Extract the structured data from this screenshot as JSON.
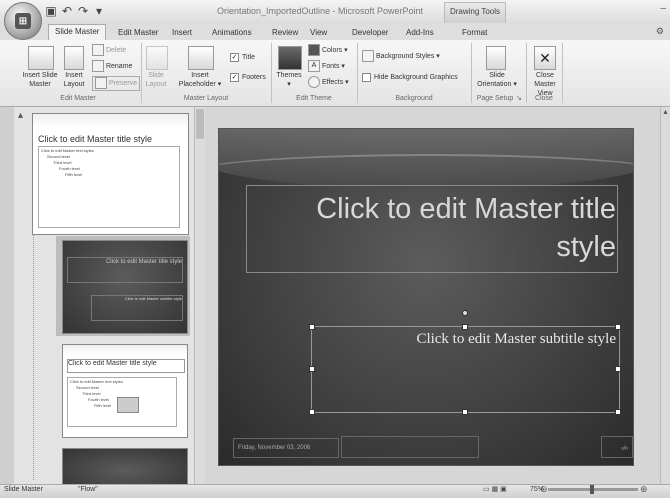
{
  "window": {
    "title": "Orientation_ImportedOutline - Microsoft PowerPoint",
    "contextual_tab_group": "Drawing Tools"
  },
  "tabs": [
    "Slide Master",
    "Edit Master",
    "Insert",
    "Animations",
    "Review",
    "View",
    "Developer",
    "Add-Ins",
    "Format"
  ],
  "active_tab": "Slide Master",
  "ribbon": {
    "edit_master": {
      "label": "Edit Master",
      "insert_slide_master": "Insert Slide\nMaster",
      "insert_layout": "Insert\nLayout",
      "delete": "Delete",
      "rename": "Rename",
      "preserve": "Preserve"
    },
    "master_layout": {
      "label": "Master Layout",
      "slide_layout": "Slide\nLayout",
      "insert_placeholder": "Insert\nPlaceholder ▾",
      "title_check": "Title",
      "footers_check": "Footers"
    },
    "edit_theme": {
      "label": "Edit Theme",
      "themes": "Themes\n▾",
      "colors": "Colors ▾",
      "fonts": "Fonts ▾",
      "effects": "Effects ▾"
    },
    "background": {
      "label": "Background",
      "background_styles": "Background Styles ▾",
      "hide_background_graphics": "Hide Background Graphics"
    },
    "page_setup": {
      "label": "Page Setup",
      "slide_orientation": "Slide\nOrientation ▾"
    },
    "close": {
      "label": "Close",
      "close_master_view": "Close\nMaster View"
    }
  },
  "thumbnails": [
    {
      "title": "Click to edit Master title style",
      "body": [
        "Click to edit Master text styles",
        "Second level",
        "Third level",
        "Fourth level",
        "Fifth level"
      ]
    },
    {
      "title": "Click to edit Master title style",
      "subtitle": "Click to edit Master subtitle style"
    },
    {
      "title": "Click to edit Master title style",
      "body": [
        "Click to edit Master text styles",
        "Second level",
        "Third level",
        "Fourth level",
        "Fifth level"
      ]
    }
  ],
  "slide": {
    "title": "Click to edit Master title style",
    "subtitle": "Click to edit Master subtitle style",
    "footer_date": "Friday, November 03, 2006",
    "slide_number": "‹#›"
  },
  "status": {
    "view": "Slide Master",
    "theme": "\"Flow\"",
    "zoom": "75%"
  }
}
